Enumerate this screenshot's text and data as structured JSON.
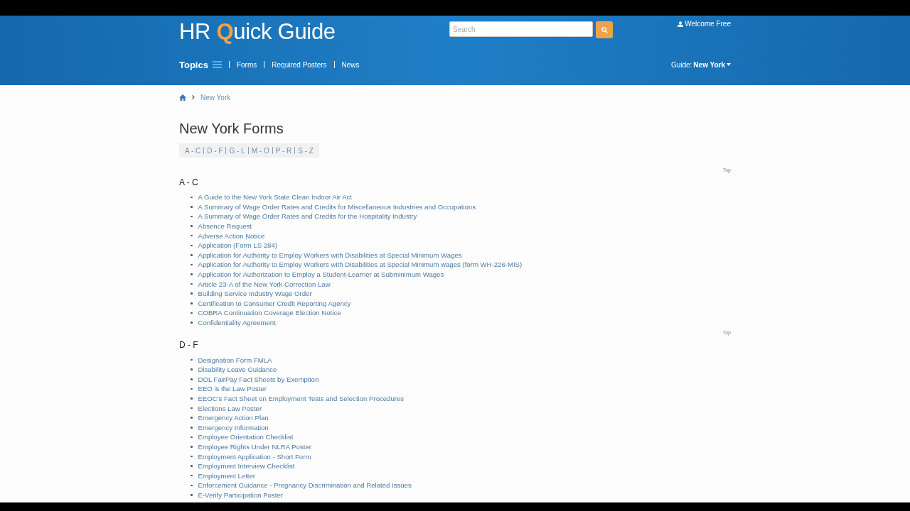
{
  "header": {
    "logo": {
      "before": "HR ",
      "mark": "Q",
      "after": "uick Guide"
    },
    "search": {
      "placeholder": "Search"
    },
    "user": "Welcome Free",
    "nav": [
      {
        "label": "Topics",
        "kind": "menu"
      },
      {
        "label": "Forms",
        "kind": "link"
      },
      {
        "label": "Required Posters",
        "kind": "link"
      },
      {
        "label": "News",
        "kind": "link"
      }
    ],
    "guide": {
      "label": "Guide:",
      "value": "New York"
    }
  },
  "breadcrumb": [
    "New York"
  ],
  "title": "New York Forms",
  "letter_index": [
    "A - C",
    "D - F",
    "G - L",
    "M - O",
    "P - R",
    "S - Z"
  ],
  "sections": [
    {
      "top": "Top",
      "heading": "A - C",
      "items": [
        "A Guide to the New York State Clean Indoor Air Act",
        "A Summary of Wage Order Rates and Credits for Miscellaneous Industries and Occupations",
        "A Summary of Wage Order Rates and Credits for the Hospitality Industry",
        "Absence Request",
        "Adverse Action Notice",
        "Application (Form LS 284)",
        "Application for Authority to Employ Workers with Disabilities at Special Minimum Wages",
        "Application for Authority to Employ Workers with Disabilities at Special Minimum wages (form WH-226-MIS)",
        "Application for Authorization to Employ a Student-Learner at Subminimum Wages",
        "Article 23-A of the New York Correction Law",
        "Building Service Industry Wage Order",
        "Certification to Consumer Credit Reporting Agency",
        "COBRA Continuation Coverage Election Notice",
        "Confidentiality Agreement"
      ]
    },
    {
      "top": "Top",
      "heading": "D - F",
      "items": [
        "Designation Form FMLA",
        "Disability Leave Guidance",
        "DOL FairPay Fact Sheets by Exemption",
        "EEO is the Law Poster",
        "EEOC's Fact Sheet on Employment Tests and Selection Procedures",
        "Elections Law Poster",
        "Emergency Action Plan",
        "Emergency Information",
        "Employee Orientation Checklist",
        "Employee Rights Under NLRA Poster",
        "Employment Application - Short Form",
        "Employment Interview Checklist",
        "Employment Letter",
        "Enforcement Guidance - Pregnancy Discrimination and Related Issues",
        "E-Verify Participation Poster"
      ]
    }
  ]
}
